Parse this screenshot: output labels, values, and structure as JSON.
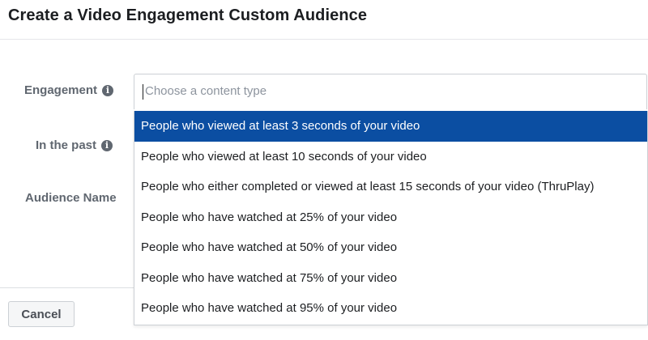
{
  "dialog": {
    "title": "Create a Video Engagement Custom Audience"
  },
  "form": {
    "engagement_label": "Engagement",
    "in_the_past_label": "In the past",
    "audience_name_label": "Audience Name",
    "content_type_placeholder": "Choose a content type",
    "info_icon": "info-icon"
  },
  "dropdown": {
    "selected_index": 0,
    "options": [
      "People who viewed at least 3 seconds of your video",
      "People who viewed at least 10 seconds of your video",
      "People who either completed or viewed at least 15 seconds of your video (ThruPlay)",
      "People who have watched at 25% of your video",
      "People who have watched at 50% of your video",
      "People who have watched at 75% of your video",
      "People who have watched at 95% of your video"
    ]
  },
  "footer": {
    "cancel_label": "Cancel"
  },
  "colors": {
    "selected_bg": "#0b4ea2",
    "label_gray": "#606770"
  }
}
